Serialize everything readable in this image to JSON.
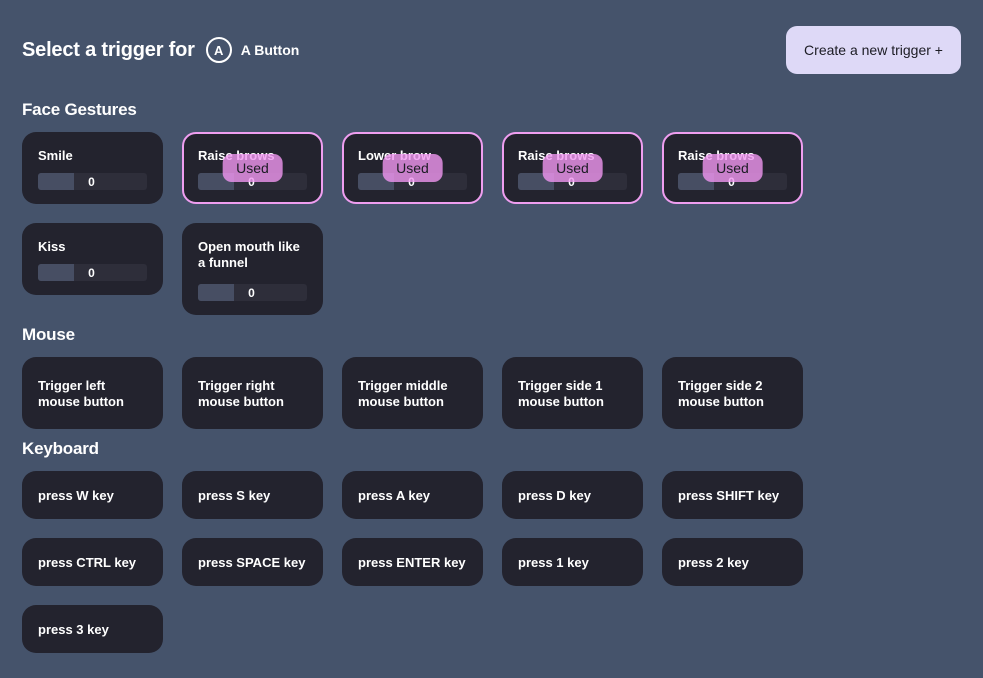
{
  "header": {
    "title": "Select a trigger for",
    "target_icon": "A",
    "target_label": "A Button",
    "create_button": "Create a new trigger +"
  },
  "colors": {
    "background": "#45536b",
    "card": "#23232e",
    "used_border": "#ef9ef0",
    "used_pill": "#f096f0",
    "create_button": "#ded9f7"
  },
  "sections": [
    {
      "title": "Face Gestures",
      "cards": [
        {
          "label": "Smile",
          "value": "0",
          "used": false,
          "used_label": ""
        },
        {
          "label": "Raise brows",
          "value": "0",
          "used": true,
          "used_label": "Used"
        },
        {
          "label": "Lower brow",
          "value": "0",
          "used": true,
          "used_label": "Used"
        },
        {
          "label": "Raise brows",
          "value": "0",
          "used": true,
          "used_label": "Used"
        },
        {
          "label": "Raise brows",
          "value": "0",
          "used": true,
          "used_label": "Used"
        },
        {
          "label": "Kiss",
          "value": "0",
          "used": false,
          "used_label": ""
        },
        {
          "label": "Open mouth like a funnel",
          "value": "0",
          "used": false,
          "used_label": ""
        }
      ]
    },
    {
      "title": "Mouse",
      "cards": [
        {
          "label": "Trigger left mouse button"
        },
        {
          "label": "Trigger right mouse button"
        },
        {
          "label": "Trigger middle mouse button"
        },
        {
          "label": "Trigger side 1 mouse button"
        },
        {
          "label": "Trigger side 2 mouse button"
        }
      ]
    },
    {
      "title": "Keyboard",
      "cards": [
        {
          "label": "press W key"
        },
        {
          "label": "press S key"
        },
        {
          "label": "press A key"
        },
        {
          "label": "press D key"
        },
        {
          "label": "press SHIFT key"
        },
        {
          "label": "press CTRL key"
        },
        {
          "label": "press SPACE key"
        },
        {
          "label": "press ENTER key"
        },
        {
          "label": "press 1 key"
        },
        {
          "label": "press 2 key"
        },
        {
          "label": "press 3 key"
        }
      ]
    }
  ]
}
